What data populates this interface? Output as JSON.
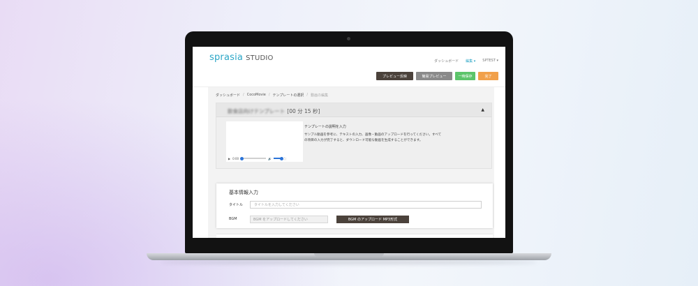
{
  "app": {
    "brand": "sprasia",
    "studio": "STUDIO"
  },
  "nav": {
    "dashboard": "ダッシュボード",
    "edit": "編集 ▾",
    "user": "SPTEST ▾"
  },
  "actions": {
    "preview_sub": "プレビュー反映",
    "preview_simple": "簡易プレビュー",
    "save_temp": "一時保存",
    "done": "完了"
  },
  "breadcrumb": {
    "items": [
      "ダッシュボード",
      "CocoMovie",
      "テンプレートの選択"
    ],
    "current": "動画の編集",
    "separator": "/"
  },
  "template": {
    "name": "飲食店向けテンプレート",
    "duration": "[00 分 15 秒]",
    "description_title": "テンプレートの説明を入力",
    "description_line1": "サンプル動画を参考に、テキストの入力、画像・動画のアップロードを行ってください。すべて",
    "description_line2": "の項目の入力が完了すると、ダウンロード可能な動画を生成することができます。",
    "player_time": "0:00"
  },
  "basic_info": {
    "heading": "基本情報入力",
    "title_label": "タイトル",
    "title_placeholder": "タイトルを入力してください",
    "bgm_label": "BGM",
    "bgm_placeholder": "BGM をアップロードしてください",
    "bgm_upload_button": "BGM のアップロード MP3形式"
  },
  "icons": {
    "play": "play-icon",
    "volume": "volume-icon",
    "fullscreen": "fullscreen-icon",
    "collapse": "chevron-up-icon"
  },
  "colors": {
    "brand": "#2ba6c6",
    "dark_button": "#4b423b",
    "gray_button": "#8a8a8a",
    "save_button": "#5cc46a",
    "done_button": "#f1a04a"
  }
}
